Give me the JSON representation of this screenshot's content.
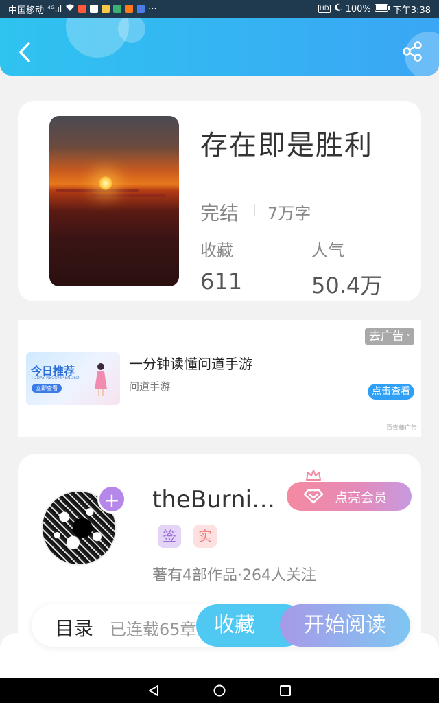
{
  "status_bar": {
    "carrier": "中国移动",
    "signal": "⁴ᴳ.ıl",
    "more": "···",
    "hd": "HD",
    "battery": "100%",
    "time": "下午3:38"
  },
  "book": {
    "title": "存在即是胜利",
    "status": "完结",
    "words": "7万字",
    "favorites_label": "收藏",
    "favorites_value": "611",
    "popularity_label": "人气",
    "popularity_value": "50.4万"
  },
  "ad": {
    "close_label": "去广告",
    "image_title": "今日推荐",
    "image_subtitle": "TODAY RECOMMENDED",
    "image_button": "立即查看",
    "title": "一分钟读懂问道手游",
    "source": "问道手游",
    "cta": "点击查看",
    "provider": "百青藤广告"
  },
  "author": {
    "name": "theBurnin…",
    "vip_label": "点亮会员",
    "badge_sign": "签",
    "badge_real": "实",
    "stats": "著有4部作品·264人关注"
  },
  "bottom_bar": {
    "toc_label": "目录",
    "toc_progress": "已连载65章",
    "collect_label": "收藏",
    "read_label": "开始阅读"
  },
  "colors": {
    "header_start": "#2fc3f0",
    "header_end": "#3aa6f5",
    "vip_gradient_start": "#f58aa0",
    "read_gradient_start": "#a79ae8",
    "collect": "#4fc9f2"
  }
}
